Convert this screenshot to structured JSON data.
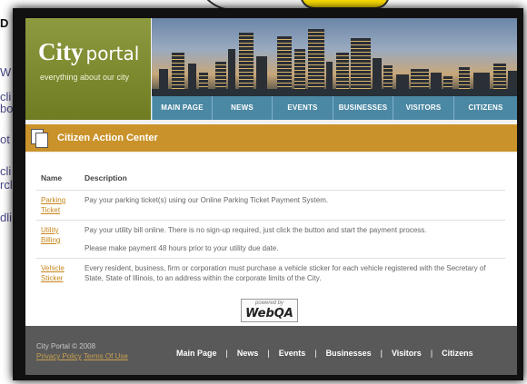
{
  "background": {
    "fragments": [
      "D",
      "W",
      "cli",
      "bo",
      "ot",
      "cli",
      "rcl",
      "dli"
    ]
  },
  "header": {
    "logo_bold": "City",
    "logo_rest": "portal",
    "tagline": "everything about our city",
    "nav": [
      "MAIN PAGE",
      "NEWS",
      "EVENTS",
      "BUSINESSES",
      "VISITORS",
      "CITIZENS"
    ]
  },
  "section": {
    "title": "Citizen Action Center",
    "icon": "documents-icon"
  },
  "table": {
    "headers": [
      "Name",
      "Description"
    ],
    "rows": [
      {
        "name": "Parking Ticket",
        "description": "Pay your parking ticket(s) using our Online Parking Ticket Payment System.",
        "note": ""
      },
      {
        "name": "Utility Billing",
        "description": "Pay your utility bill online. There is no sign-up required, just click the button and start the payment process.",
        "note": "Please make payment 48 hours prior to your utility due date."
      },
      {
        "name": "Vehicle Sticker",
        "description": "Every resident, business, firm or corporation must purchase a vehicle sticker for each vehicle registered with the Secretary of State, State of Illinois, to an address within the corporate limits of the City.",
        "note": ""
      }
    ]
  },
  "powered_by": {
    "small": "powered by",
    "logo": "WebQA"
  },
  "footer": {
    "copyright": "City Portal © 2008",
    "privacy": "Privacy Policy",
    "terms": "Terms Of Use",
    "nav": [
      "Main Page",
      "News",
      "Events",
      "Businesses",
      "Visitors",
      "Citizens"
    ]
  },
  "colors": {
    "logo_green": "#7a872c",
    "nav_blue": "#4b88a4",
    "section_gold": "#c9922a",
    "footer_gray": "#595959",
    "link_orange": "#c8861a"
  }
}
